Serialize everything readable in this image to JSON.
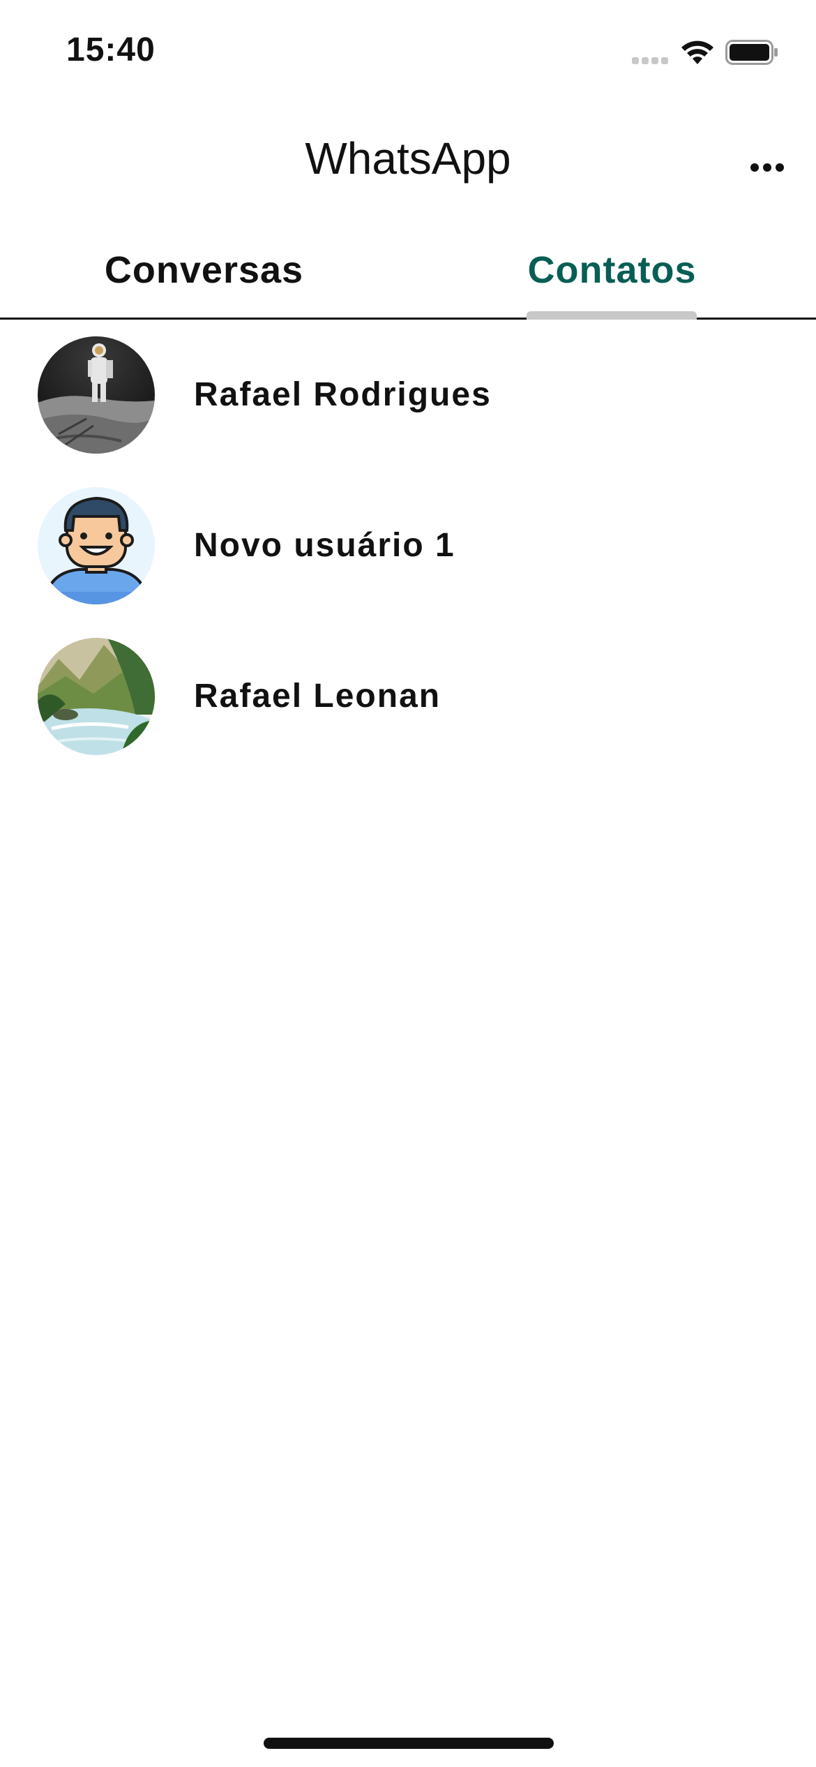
{
  "status_bar": {
    "time": "15:40",
    "signal_icon": "signal-dots-icon",
    "wifi_icon": "wifi-icon",
    "battery_icon": "battery-icon"
  },
  "app_bar": {
    "title": "WhatsApp",
    "menu_icon": "more-horizontal-icon"
  },
  "tabs": [
    {
      "label": "Conversas",
      "selected": false
    },
    {
      "label": "Contatos",
      "selected": true
    }
  ],
  "colors": {
    "accent": "#075e54",
    "text": "#111111",
    "indicator": "#c8c8c8",
    "background": "#ffffff"
  },
  "contacts": [
    {
      "name": "Rafael Rodrigues",
      "avatar": "astronaut-photo"
    },
    {
      "name": "Novo usuário 1",
      "avatar": "cartoon-man-avatar"
    },
    {
      "name": "Rafael Leonan",
      "avatar": "river-landscape-illustration"
    }
  ]
}
